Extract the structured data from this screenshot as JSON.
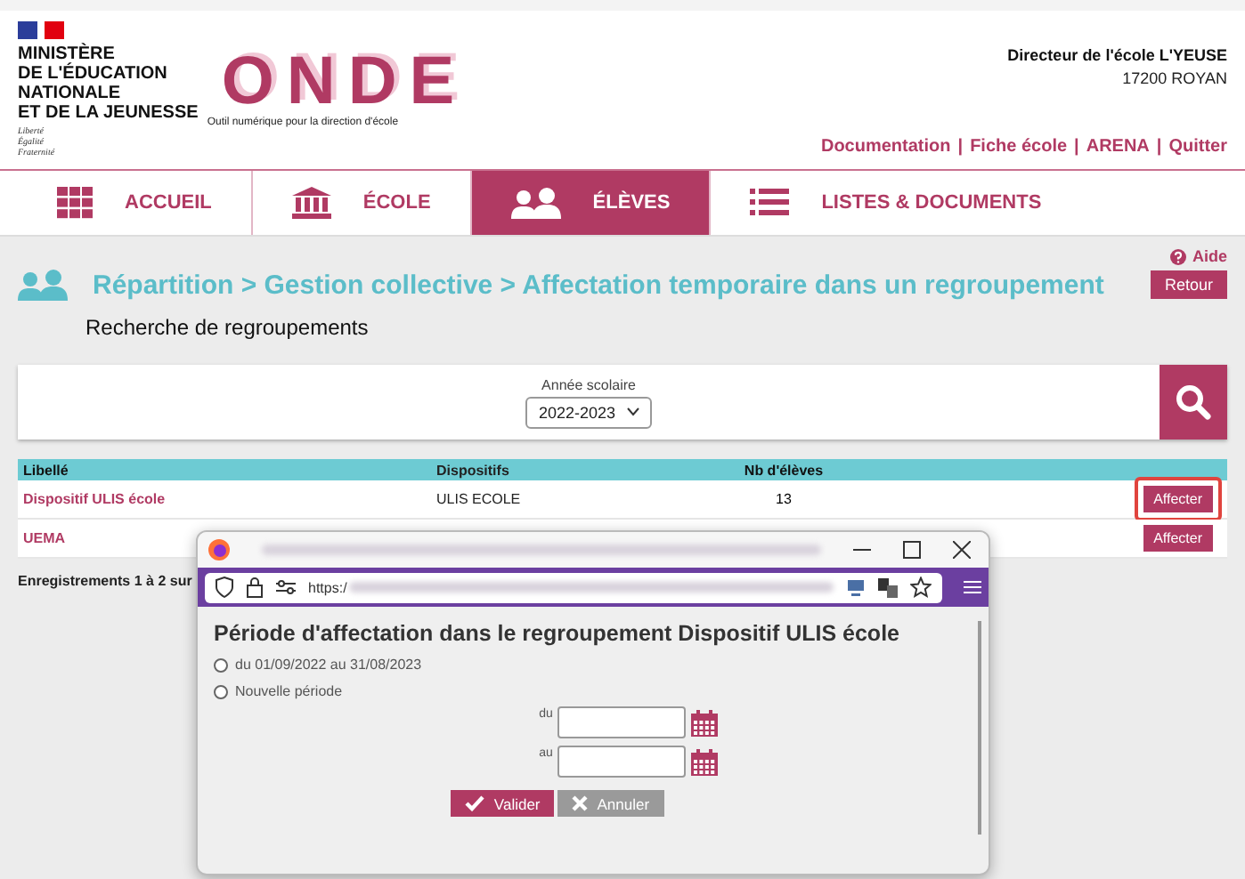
{
  "header": {
    "ministry": [
      "MINISTÈRE",
      "DE L'ÉDUCATION",
      "NATIONALE",
      "ET DE LA JEUNESSE"
    ],
    "motto": [
      "Liberté",
      "Égalité",
      "Fraternité"
    ],
    "app_name": "ONDE",
    "tagline": "Outil numérique pour la direction d'école",
    "user": "Directeur de l'école L'YEUSE",
    "city": "17200 ROYAN",
    "links": [
      "Documentation",
      "Fiche école",
      "ARENA",
      "Quitter"
    ],
    "separator": "|"
  },
  "nav": [
    {
      "label": "ACCUEIL",
      "selected": false
    },
    {
      "label": "ÉCOLE",
      "selected": false
    },
    {
      "label": "ÉLÈVES",
      "selected": true
    },
    {
      "label": "LISTES & DOCUMENTS",
      "selected": false
    }
  ],
  "help": "Aide",
  "title": "Répartition > Gestion collective > Affectation temporaire dans un regroupement",
  "back_button": "Retour",
  "subtitle": "Recherche de regroupements",
  "search": {
    "label": "Année scolaire",
    "value": "2022-2023"
  },
  "table": {
    "columns": [
      "Libellé",
      "Dispositifs",
      "Nb d'élèves"
    ],
    "rows": [
      {
        "cells": [
          "Dispositif ULIS école",
          "ULIS ECOLE",
          "13"
        ],
        "action": "Affecter",
        "highlighted": true
      },
      {
        "cells": [
          "UEMA",
          "",
          ""
        ],
        "action": "Affecter",
        "highlighted": false
      }
    ]
  },
  "records": "Enregistrements 1 à 2 sur",
  "popup": {
    "url": "https:/",
    "title": "Période d'affectation dans le regroupement Dispositif ULIS école",
    "options": [
      {
        "label": "du 01/09/2022 au 31/08/2023",
        "selected": false
      },
      {
        "label": "Nouvelle période",
        "selected": false
      }
    ],
    "fields": [
      {
        "label": "du"
      },
      {
        "label": "au"
      }
    ],
    "buttons": [
      {
        "label": "Valider",
        "kind": "primary"
      },
      {
        "label": "Annuler",
        "kind": "secondary"
      }
    ]
  }
}
